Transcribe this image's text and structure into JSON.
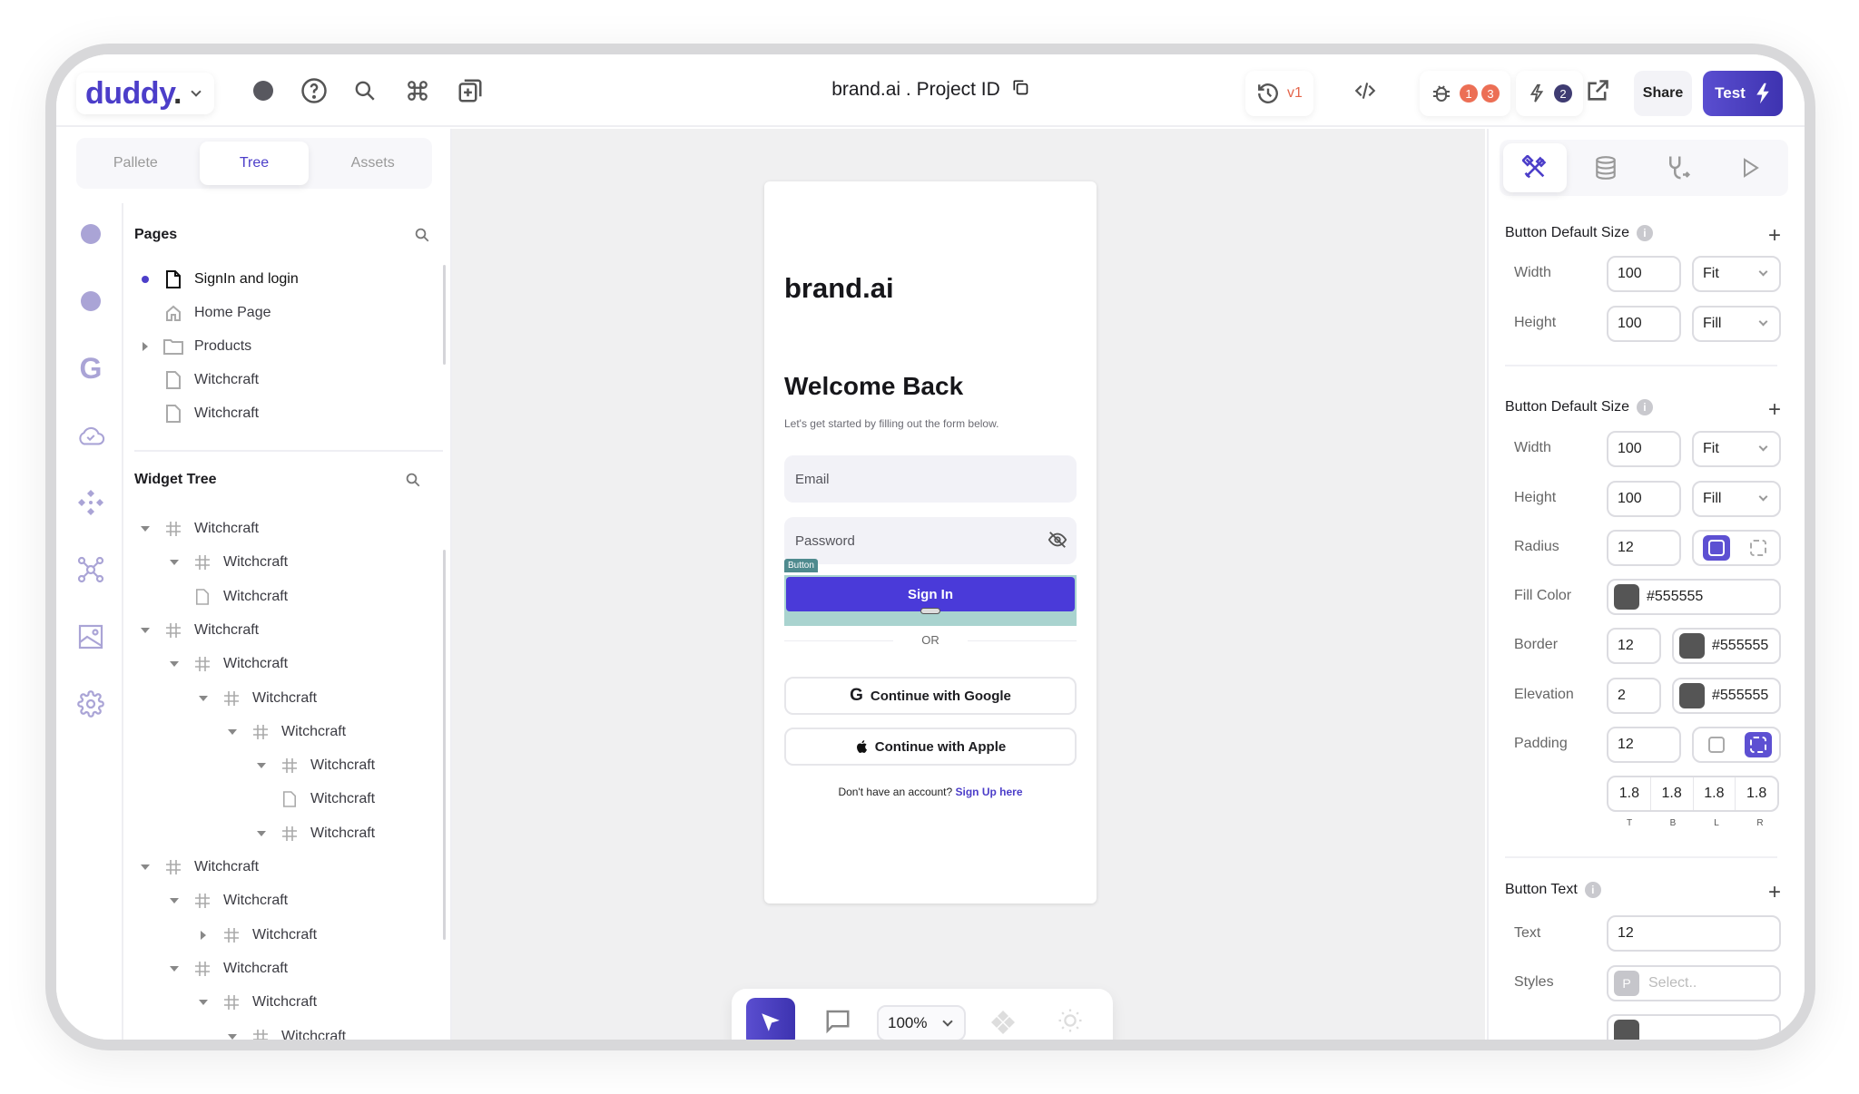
{
  "header": {
    "logo": "duddy",
    "logo_dot": ".",
    "project_title": "brand.ai . Project ID",
    "version_label": "v1",
    "bug_badges": [
      "1",
      "3"
    ],
    "flash_badge": "2",
    "share_label": "Share",
    "test_label": "Test"
  },
  "colors": {
    "accent": "#4c3ec9",
    "badge_red": "#ec6f55",
    "badge_dark": "#3f3c72",
    "selection_teal": "#4e8a8e"
  },
  "left_tabs": [
    {
      "label": "Pallete",
      "active": false
    },
    {
      "label": "Tree",
      "active": true
    },
    {
      "label": "Assets",
      "active": false
    }
  ],
  "rail_icons": [
    "dot",
    "dot",
    "google-icon",
    "cloud-check-icon",
    "components-icon",
    "network-icon",
    "image-icon",
    "settings-icon"
  ],
  "pages": {
    "title": "Pages",
    "items": [
      {
        "label": "SignIn and login",
        "icon": "page",
        "selected": true
      },
      {
        "label": "Home Page",
        "icon": "home"
      },
      {
        "label": "Products",
        "icon": "folder",
        "expandable": true
      },
      {
        "label": "Witchcraft",
        "icon": "page"
      },
      {
        "label": "Witchcraft",
        "icon": "page"
      }
    ]
  },
  "widget_tree": {
    "title": "Widget Tree",
    "items": [
      {
        "label": "Witchcraft",
        "depth": 0,
        "caret": "down",
        "icon": "grid"
      },
      {
        "label": "Witchcraft",
        "depth": 1,
        "caret": "down",
        "icon": "grid"
      },
      {
        "label": "Witchcraft",
        "depth": 1,
        "caret": "none",
        "icon": "page"
      },
      {
        "label": "Witchcraft",
        "depth": 0,
        "caret": "down",
        "icon": "grid"
      },
      {
        "label": "Witchcraft",
        "depth": 1,
        "caret": "down",
        "icon": "grid"
      },
      {
        "label": "Witchcraft",
        "depth": 2,
        "caret": "down",
        "icon": "grid"
      },
      {
        "label": "Witchcraft",
        "depth": 3,
        "caret": "down",
        "icon": "grid"
      },
      {
        "label": "Witchcraft",
        "depth": 4,
        "caret": "down",
        "icon": "grid"
      },
      {
        "label": "Witchcraft",
        "depth": 4,
        "caret": "none",
        "icon": "page"
      },
      {
        "label": "Witchcraft",
        "depth": 4,
        "caret": "down",
        "icon": "grid"
      },
      {
        "label": "Witchcraft",
        "depth": 0,
        "caret": "down",
        "icon": "grid"
      },
      {
        "label": "Witchcraft",
        "depth": 1,
        "caret": "down",
        "icon": "grid"
      },
      {
        "label": "Witchcraft",
        "depth": 2,
        "caret": "right",
        "icon": "grid"
      },
      {
        "label": "Witchcraft",
        "depth": 1,
        "caret": "down",
        "icon": "grid"
      },
      {
        "label": "Witchcraft",
        "depth": 2,
        "caret": "down",
        "icon": "grid"
      },
      {
        "label": "Witchcraft",
        "depth": 3,
        "caret": "down",
        "icon": "grid"
      }
    ]
  },
  "phone": {
    "brand": "brand.ai",
    "welcome": "Welcome Back",
    "subtitle": "Let's get started by filling out the form below.",
    "email_placeholder": "Email",
    "password_placeholder": "Password",
    "selection_tag": "Button",
    "signin_label": "Sign In",
    "or_label": "OR",
    "google_label": "Continue with Google",
    "apple_label": "Continue with Apple",
    "signup_prompt": "Don't have an account?",
    "signup_link": "Sign Up here"
  },
  "canvas_toolbar": {
    "zoom": "100%"
  },
  "properties": {
    "tabs": [
      "design-icon",
      "database-icon",
      "stethoscope-icon",
      "play-icon"
    ],
    "section1": {
      "title": "Button Default Size",
      "width_label": "Width",
      "width_value": "100",
      "width_mode": "Fit",
      "height_label": "Height",
      "height_value": "100",
      "height_mode": "Fill"
    },
    "section2": {
      "title": "Button Default Size",
      "width_label": "Width",
      "width_value": "100",
      "width_mode": "Fit",
      "height_label": "Height",
      "height_value": "100",
      "height_mode": "Fill",
      "radius_label": "Radius",
      "radius_value": "12",
      "fill_label": "Fill Color",
      "fill_value": "#555555",
      "border_label": "Border",
      "border_value": "12",
      "border_color": "#555555",
      "elevation_label": "Elevation",
      "elevation_value": "2",
      "elevation_color": "#555555",
      "padding_label": "Padding",
      "padding_value": "12",
      "padding_sides": [
        {
          "value": "1.8",
          "label": "T"
        },
        {
          "value": "1.8",
          "label": "B"
        },
        {
          "value": "1.8",
          "label": "L"
        },
        {
          "value": "1.8",
          "label": "R"
        }
      ]
    },
    "section3": {
      "title": "Button Text",
      "text_label": "Text",
      "text_value": "12",
      "styles_label": "Styles",
      "styles_badge": "P",
      "styles_placeholder": "Select.."
    }
  }
}
